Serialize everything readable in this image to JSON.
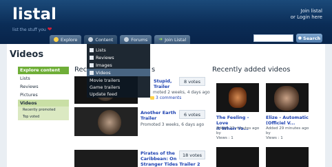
{
  "header": {
    "logo": "listal",
    "tagline": "list the stuff you",
    "join_line1": "Join listal",
    "join_line2": "or Login here"
  },
  "nav": {
    "tabs": [
      {
        "label": "Explore",
        "icon": "explore-icon"
      },
      {
        "label": "Content",
        "icon": "content-icon"
      },
      {
        "label": "Forums",
        "icon": "forums-icon"
      },
      {
        "label": "Join Listal",
        "icon": "arrow-icon"
      }
    ]
  },
  "search": {
    "button_label": "Search",
    "placeholder": ""
  },
  "page": {
    "title": "Videos"
  },
  "sidebar": {
    "header": "Explore content",
    "items": [
      "Lists",
      "Reviews",
      "Pictures",
      "Videos"
    ],
    "sub_items": [
      "Recently promoted",
      "Top voted"
    ]
  },
  "dropdown": {
    "items": [
      "Lists",
      "Reviews",
      "Images",
      "Videos",
      "Movie trailers",
      "Game trailers",
      "Update feed"
    ],
    "highlighted": "Videos"
  },
  "recently_promoted": {
    "title_visible_left": "Rec",
    "title_visible_right": "s",
    "videos": [
      {
        "title_line1": "Stupid,",
        "title_line2": "Trailer",
        "meta": "moted 2 weeks, 4 days ago",
        "votes": "8 votes",
        "comments": "3 comments"
      },
      {
        "title_line1": "Another Earth",
        "title_line2": "Trailer",
        "meta": "Promoted 3 weeks, 6 days ago",
        "votes": "6 votes"
      },
      {
        "title_line1": "Pirates of the",
        "title_line2": "Caribbean: On",
        "title_line3": "Stranger Tides Trailer 2",
        "votes": "18 votes"
      }
    ]
  },
  "recently_added": {
    "title": "Recently added videos",
    "videos": [
      {
        "title_line1": "The Feeling - Love",
        "title_line2": "It When Yo...",
        "meta1": "Added 27 minutes ago",
        "meta2": "by",
        "meta3": "Views : 1"
      },
      {
        "title_line1": "Elize - Automatic",
        "title_line2": "(Officiel V...",
        "meta1": "Added 29 minutes ago",
        "meta2": "by",
        "meta3": "Views : 1"
      }
    ]
  }
}
